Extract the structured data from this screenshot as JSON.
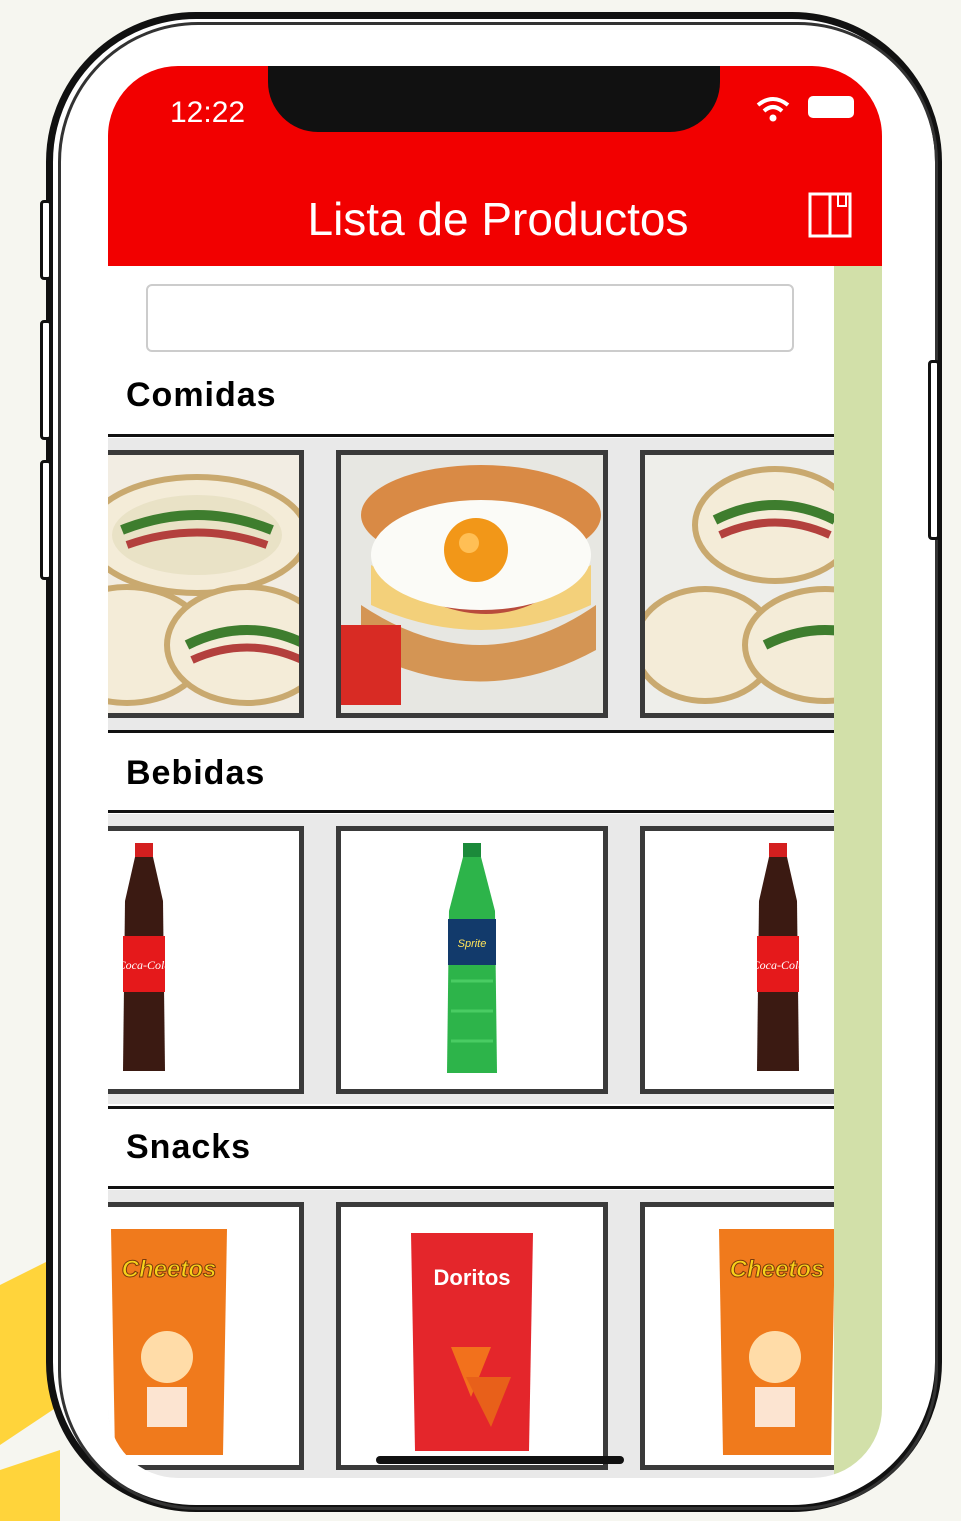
{
  "status_bar": {
    "time": "12:22"
  },
  "header": {
    "title": "Lista de Productos",
    "menu_icon": "book-icon"
  },
  "search": {
    "value": "",
    "placeholder": ""
  },
  "colors": {
    "header": "#f20000",
    "sidebar": "#d2e0a9"
  },
  "sections": [
    {
      "title": "Comidas",
      "products": [
        {
          "icon": "sandwich-wrap-image"
        },
        {
          "icon": "egg-burger-image"
        },
        {
          "icon": "sandwich-wrap-image"
        }
      ]
    },
    {
      "title": "Bebidas",
      "products": [
        {
          "icon": "cola-bottle-image",
          "label": "Coca-Cola"
        },
        {
          "icon": "sprite-bottle-image",
          "label": "Sprite"
        },
        {
          "icon": "cola-bottle-image",
          "label": "Coca-Cola"
        }
      ]
    },
    {
      "title": "Snacks",
      "products": [
        {
          "icon": "cheetos-bag-image",
          "label": "Cheetos"
        },
        {
          "icon": "doritos-bag-image",
          "label": "Doritos"
        },
        {
          "icon": "cheetos-bag-image",
          "label": "Cheetos"
        }
      ]
    }
  ]
}
